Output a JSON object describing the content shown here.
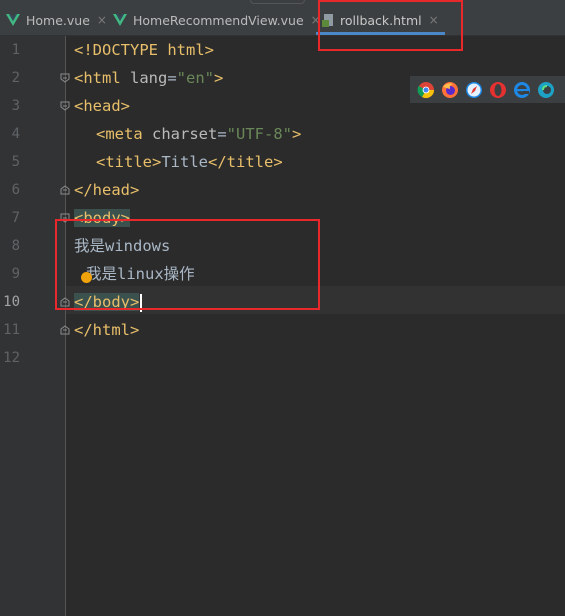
{
  "tabs": [
    {
      "label": "Home.vue",
      "close": "×"
    },
    {
      "label": "HomeRecommendView.vue",
      "close": "×"
    },
    {
      "label": "rollback.html",
      "close": "×"
    }
  ],
  "line_numbers": [
    "1",
    "2",
    "3",
    "4",
    "5",
    "6",
    "7",
    "8",
    "9",
    "10",
    "11",
    "12"
  ],
  "code": {
    "l1_tag": "<!DOCTYPE html>",
    "l2_open": "<html ",
    "l2_attr": "lang",
    "l2_eq": "=",
    "l2_val": "\"en\"",
    "l2_close": ">",
    "l3": "<head>",
    "l4_open": "<meta ",
    "l4_attr": "charset",
    "l4_eq": "=",
    "l4_val": "\"UTF-8\"",
    "l4_close": ">",
    "l5_open": "<title>",
    "l5_text": "Title",
    "l5_close": "</title>",
    "l6": "</head>",
    "l7": "<body>",
    "l8": "我是windows",
    "l9": "我是linux操作",
    "l10": "</body>",
    "l11": "</html>"
  },
  "browser_icons": [
    "chrome-icon",
    "firefox-icon",
    "safari-icon",
    "opera-icon",
    "ie-icon",
    "edge-icon"
  ]
}
